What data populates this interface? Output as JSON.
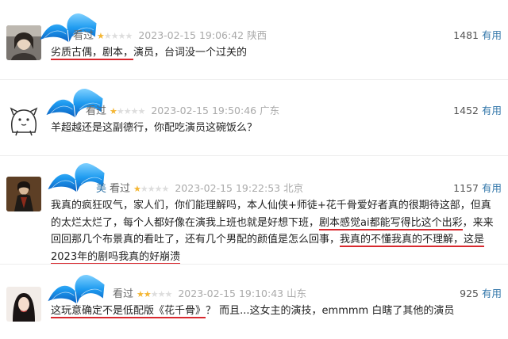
{
  "reviews": [
    {
      "user": "",
      "rated_label": "看过",
      "stars": 1,
      "time": "2023-02-15 19:06:42",
      "location": "陕西",
      "votes": "1481",
      "vote_label": "有用",
      "text": "劣质古偶，剧本，演员，台词没一个过关的",
      "underlined": [
        "劣质古偶，",
        "剧本，"
      ]
    },
    {
      "user": "",
      "rated_label": "看过",
      "stars": 1,
      "time": "2023-02-15 19:50:46",
      "location": "广东",
      "votes": "1452",
      "vote_label": "有用",
      "text": "羊超越还是这副德行，你配吃演员这碗饭么？"
    },
    {
      "user": "美",
      "rated_label": "看过",
      "stars": 1,
      "time": "2023-02-15 19:22:53",
      "location": "北京",
      "votes": "1157",
      "vote_label": "有用",
      "text_parts": [
        "我真的疯狂叹气，家人们，你们能理解吗，本人仙侠+师徒+花千骨爱好者真的很期待这部，但真的太烂太烂了，每个人都好像在演我上班也就是好想下班，",
        "剧本感觉ai都能写得比这个出彩",
        "，来来回回那几个布景真的看吐了，还有几个男配的颜值是怎么回事，",
        "我真的不懂我真的不理解，这是2023年的剧吗我真的好崩溃"
      ]
    },
    {
      "user": "",
      "rated_label": "看过",
      "stars": 2,
      "time": "2023-02-15 19:10:43",
      "location": "山东",
      "votes": "925",
      "vote_label": "有用",
      "text_parts": [
        "这玩意确定不是低配版《花千骨》",
        "？ 而且...这女主的演技，emmmm 白瞎了其他的演员"
      ]
    }
  ]
}
